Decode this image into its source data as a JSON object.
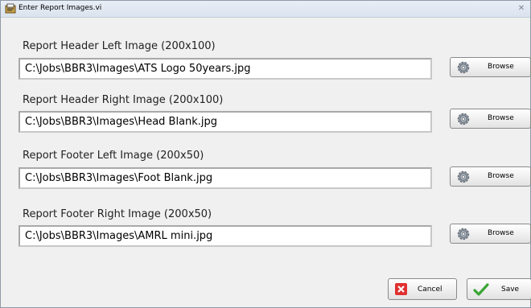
{
  "window": {
    "title": "Enter Report Images.vi",
    "close_glyph": "✕"
  },
  "fields": [
    {
      "label": "Report Header Left Image (200x100)",
      "value": "C:\\Jobs\\BBR3\\Images\\ATS Logo 50years.jpg",
      "button_label": "Browse"
    },
    {
      "label": "Report Header Right Image (200x100)",
      "value": "C:\\Jobs\\BBR3\\Images\\Head Blank.jpg",
      "button_label": "Browse"
    },
    {
      "label": "Report Footer Left Image (200x50)",
      "value": "C:\\Jobs\\BBR3\\Images\\Foot Blank.jpg",
      "button_label": "Browse"
    },
    {
      "label": "Report Footer Right Image (200x50)",
      "value": "C:\\Jobs\\BBR3\\Images\\AMRL mini.jpg",
      "button_label": "Browse"
    }
  ],
  "actions": {
    "cancel_label": "Cancel",
    "save_label": "Save"
  },
  "colors": {
    "cancel_red": "#e03030",
    "save_green": "#3aa635"
  },
  "icons": {
    "browse": "gear-icon",
    "cancel": "x-icon",
    "save": "checkmark-icon",
    "app": "vi-icon"
  }
}
